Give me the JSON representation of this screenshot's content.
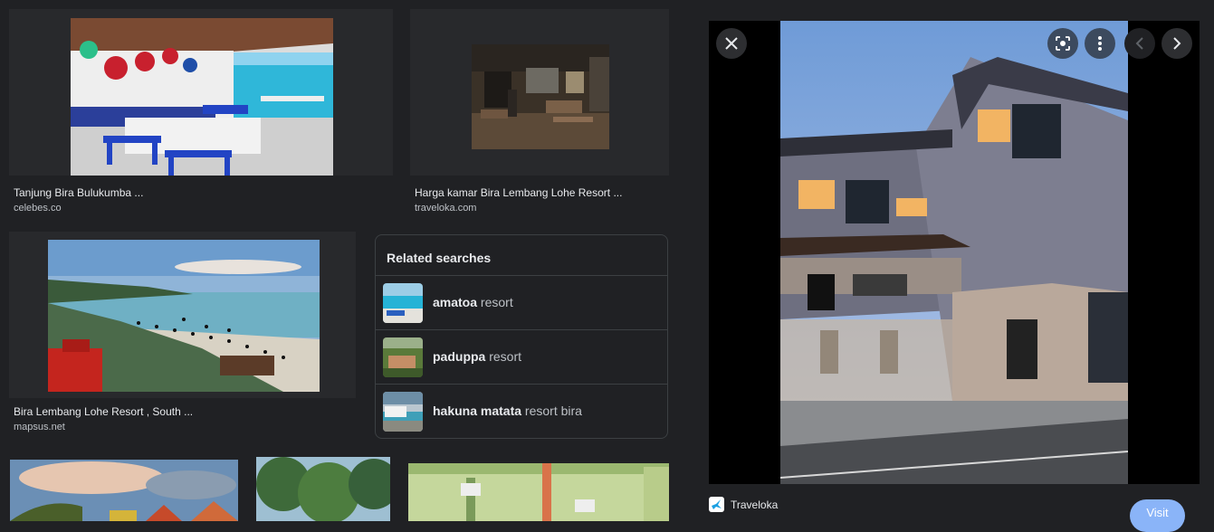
{
  "results": [
    {
      "caption": "Tanjung Bira Bulukumba ...",
      "source": "celebes.co"
    },
    {
      "caption": "Harga kamar Bira Lembang Lohe Resort ...",
      "source": "traveloka.com"
    },
    {
      "caption": "Bira Lembang Lohe Resort , South ...",
      "source": "mapsus.net"
    }
  ],
  "related": {
    "title": "Related searches",
    "items": [
      {
        "bold": "amatoa",
        "rest": " resort"
      },
      {
        "bold": "paduppa",
        "rest": " resort"
      },
      {
        "bold": "hakuna matata",
        "rest": " resort bira"
      }
    ]
  },
  "viewer": {
    "site_name": "Traveloka",
    "visit_label": "Visit"
  },
  "icons": {
    "close": "close-icon",
    "lens": "lens-icon",
    "more": "more-vert-icon",
    "prev": "chevron-left-icon",
    "next": "chevron-right-icon"
  }
}
